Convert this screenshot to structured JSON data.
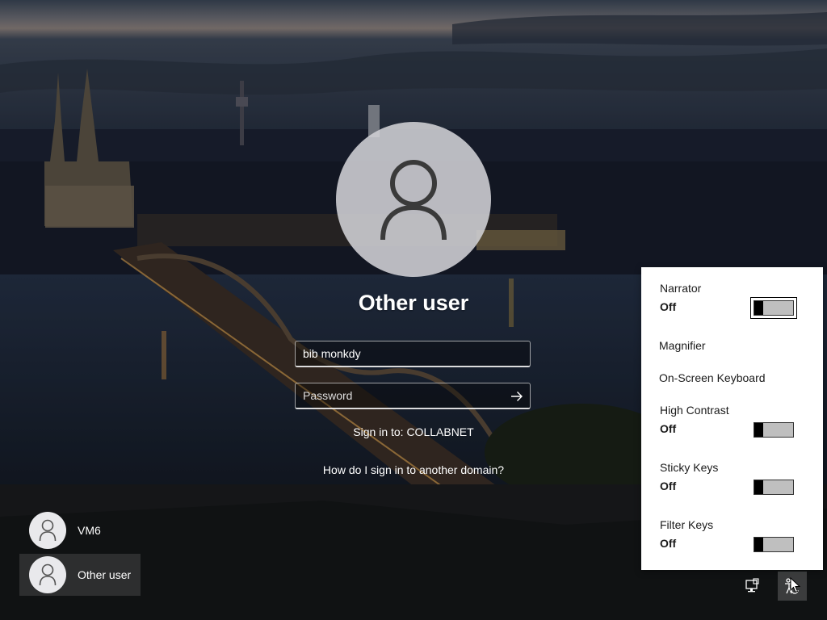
{
  "login": {
    "user_title": "Other user",
    "username_value": "bib monkdy",
    "password_placeholder": "Password",
    "sign_in_to": "Sign in to: COLLABNET",
    "domain_link": "How do I sign in to another domain?",
    "submit_icon": "arrow-right-icon",
    "avatar_icon": "person-icon"
  },
  "users": [
    {
      "name": "VM6",
      "selected": false
    },
    {
      "name": "Other user",
      "selected": true
    }
  ],
  "ease_of_access": {
    "items": [
      {
        "label": "Narrator",
        "state": "Off",
        "has_toggle": true
      },
      {
        "label": "Magnifier",
        "has_toggle": false
      },
      {
        "label": "On-Screen Keyboard",
        "has_toggle": false
      },
      {
        "label": "High Contrast",
        "state": "Off",
        "has_toggle": true
      },
      {
        "label": "Sticky Keys",
        "state": "Off",
        "has_toggle": true
      },
      {
        "label": "Filter Keys",
        "state": "Off",
        "has_toggle": true
      }
    ]
  },
  "tray": {
    "network_icon": "network-icon",
    "ease_icon": "ease-of-access-icon"
  }
}
